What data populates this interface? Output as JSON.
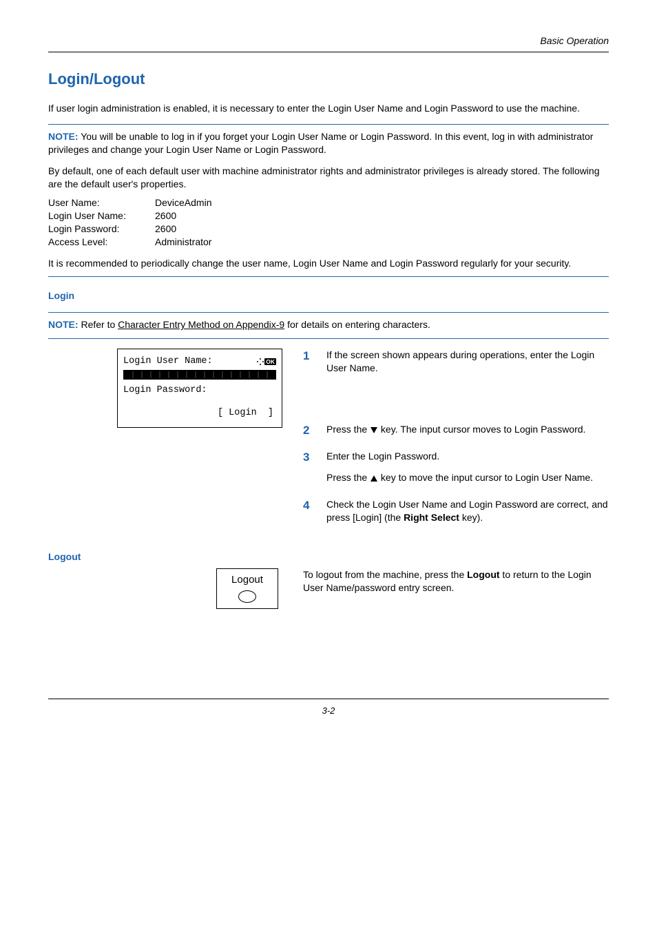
{
  "header": {
    "page_label": "Basic Operation"
  },
  "title": "Login/Logout",
  "intro": "If user login administration is enabled, it is necessary to enter the Login User Name and Login Password to use the machine.",
  "note1": {
    "label": "NOTE:",
    "text1": "You will be unable to log in if you forget your Login User Name or Login Password. In this event, log in with administrator privileges and change your Login User Name or Login Password.",
    "text2": "By default, one of each default user with machine administrator rights and administrator privileges is already stored. The following are the default user's properties.",
    "props": [
      {
        "label": "User Name:",
        "value": "DeviceAdmin"
      },
      {
        "label": "Login User Name:",
        "value": "2600"
      },
      {
        "label": "Login Password:",
        "value": "2600"
      },
      {
        "label": "Access Level:",
        "value": "Administrator"
      }
    ],
    "text3": "It is recommended to periodically change the user name, Login User Name and Login Password regularly for your security."
  },
  "login": {
    "heading": "Login",
    "note_label": "NOTE:",
    "note_pre": "Refer to ",
    "note_link": "Character Entry Method on Appendix-9",
    "note_post": " for details on entering characters.",
    "panel": {
      "line1": "Login User Name:",
      "ok": "OK",
      "line2": "Login Password:",
      "login_btn": "[ Login  ]"
    },
    "steps": {
      "s1": "If the screen shown appears during operations, enter the Login User Name.",
      "s2_pre": "Press the ",
      "s2_post": " key. The input cursor moves to Login Password.",
      "s3a": "Enter the Login Password.",
      "s3b_pre": "Press the ",
      "s3b_post": " key to move the input cursor to Login User Name.",
      "s4_pre": "Check the Login User Name and Login Password are correct, and press [Login] (the ",
      "s4_bold": "Right Select",
      "s4_post": " key)."
    }
  },
  "logout": {
    "heading": "Logout",
    "box_label": "Logout",
    "text_pre": "To logout from the machine, press the ",
    "text_bold": "Logout",
    "text_post": " to return to the Login User Name/password entry screen."
  },
  "footer": {
    "page_number": "3-2"
  }
}
